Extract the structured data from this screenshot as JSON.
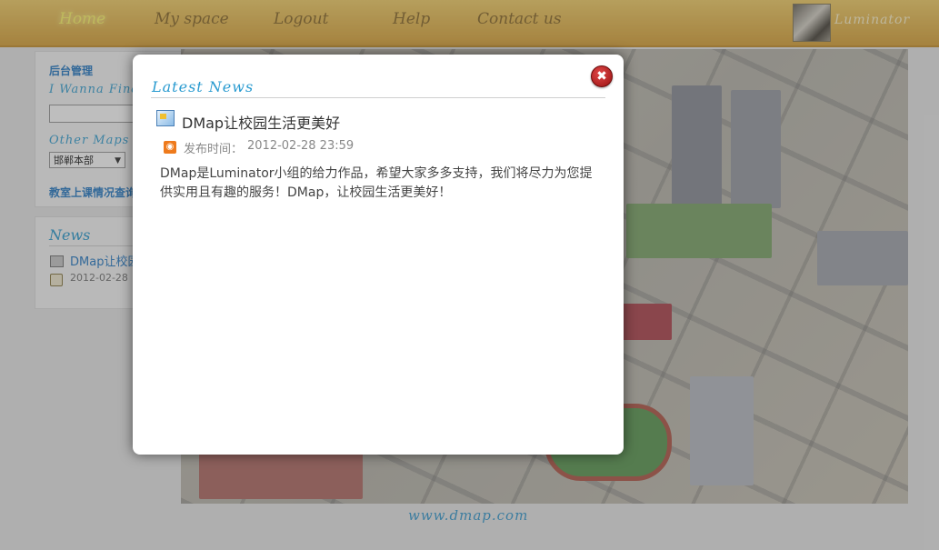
{
  "nav": {
    "items": [
      {
        "label": "Home",
        "active": true
      },
      {
        "label": "My space",
        "active": false
      },
      {
        "label": "Logout",
        "active": false
      },
      {
        "label": "Help",
        "active": false
      },
      {
        "label": "Contact us",
        "active": false
      }
    ],
    "username": "Luminator"
  },
  "sidebar": {
    "admin_title": "后台管理",
    "wanna_label": "I Wanna Find",
    "search_value": "",
    "other_maps_label": "Other Maps",
    "map_selected": "邯郸本部",
    "classroom_link": "教室上课情况查询",
    "news_title": "News",
    "news_item": "DMap让校园生活更美好",
    "news_date": "2012-02-28"
  },
  "footer": {
    "url": "www.dmap.com"
  },
  "modal": {
    "title": "Latest News",
    "close_label": "✖",
    "article_title": "DMap让校园生活更美好",
    "published_label": "发布时间：",
    "published_time": "2012-02-28 23:59",
    "body": "DMap是Luminator小组的给力作品，希望大家多多支持，我们将尽力为您提供实用且有趣的服务！DMap，让校园生活更美好！"
  },
  "colors": {
    "accent_blue": "#2a9bd0",
    "nav_gold": "#d9a43c",
    "close_red": "#c0201f"
  }
}
